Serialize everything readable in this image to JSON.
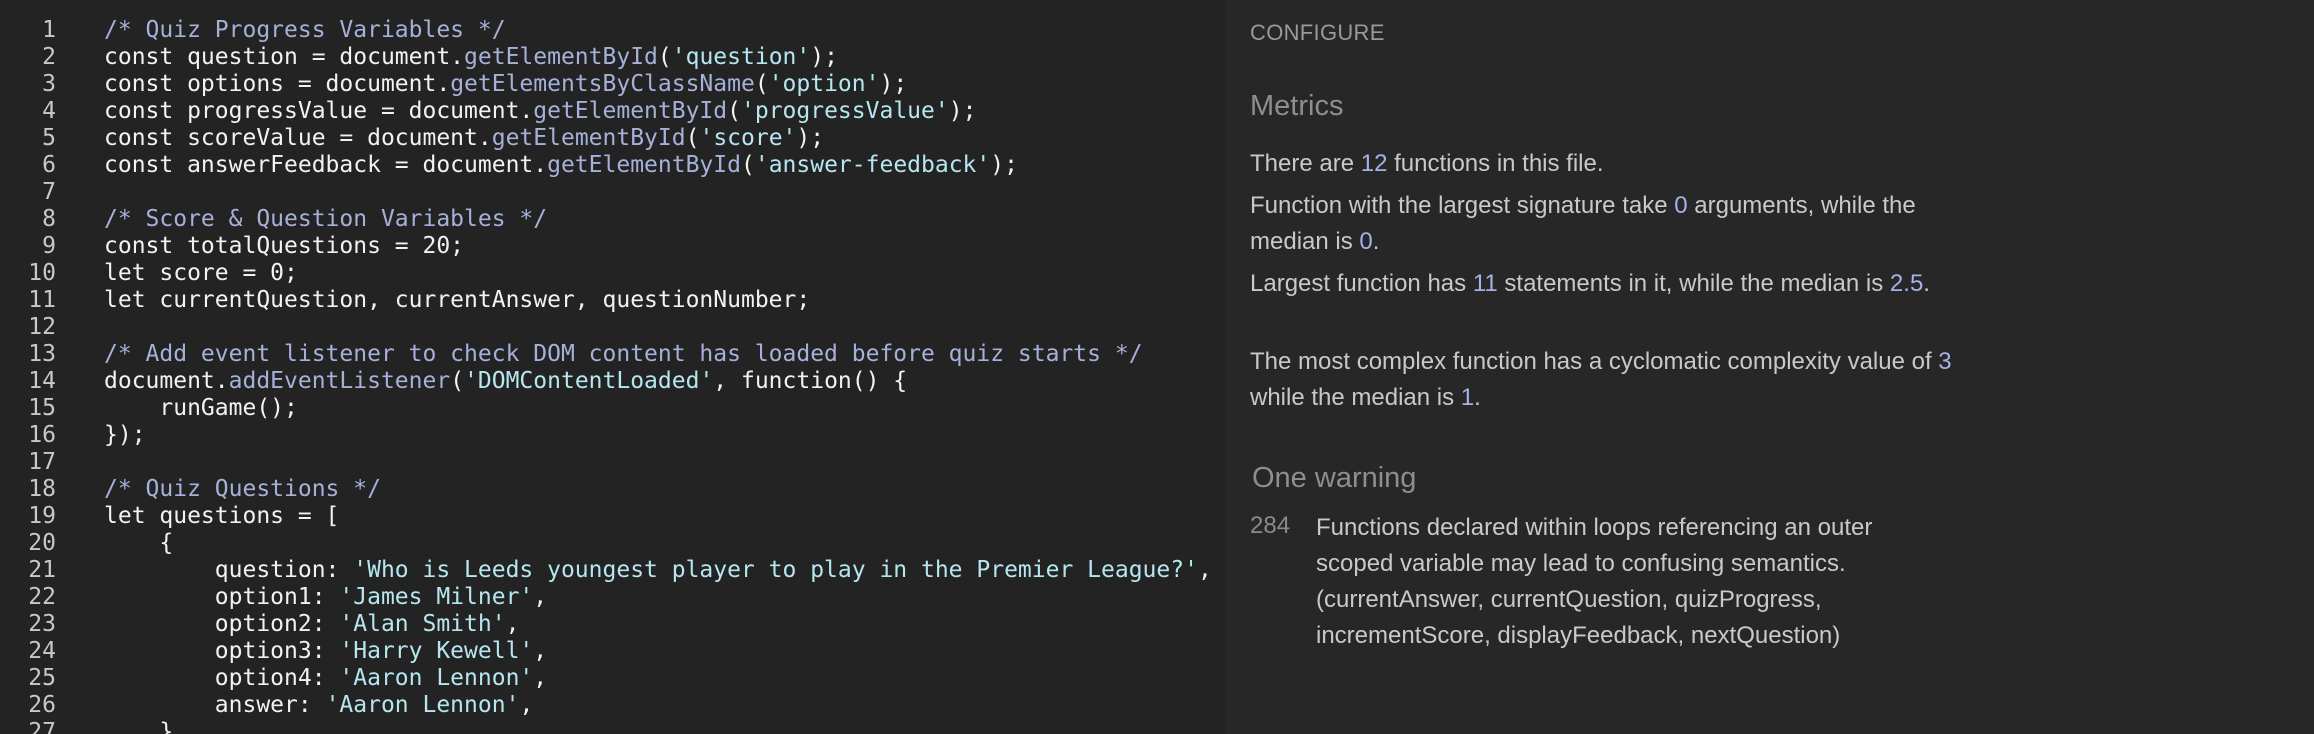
{
  "editor": {
    "lines": [
      {
        "n": "1",
        "segments": [
          {
            "t": "/* Quiz Progress Variables */",
            "c": "comment"
          }
        ]
      },
      {
        "n": "2",
        "segments": [
          {
            "t": "const question = document.",
            "c": "plain"
          },
          {
            "t": "getElementById",
            "c": "method"
          },
          {
            "t": "(",
            "c": "plain"
          },
          {
            "t": "'question'",
            "c": "string"
          },
          {
            "t": ");",
            "c": "plain"
          }
        ]
      },
      {
        "n": "3",
        "segments": [
          {
            "t": "const options = document.",
            "c": "plain"
          },
          {
            "t": "getElementsByClassName",
            "c": "method"
          },
          {
            "t": "(",
            "c": "plain"
          },
          {
            "t": "'option'",
            "c": "string"
          },
          {
            "t": ");",
            "c": "plain"
          }
        ]
      },
      {
        "n": "4",
        "segments": [
          {
            "t": "const progressValue = document.",
            "c": "plain"
          },
          {
            "t": "getElementById",
            "c": "method"
          },
          {
            "t": "(",
            "c": "plain"
          },
          {
            "t": "'progressValue'",
            "c": "string"
          },
          {
            "t": ");",
            "c": "plain"
          }
        ]
      },
      {
        "n": "5",
        "segments": [
          {
            "t": "const scoreValue = document.",
            "c": "plain"
          },
          {
            "t": "getElementById",
            "c": "method"
          },
          {
            "t": "(",
            "c": "plain"
          },
          {
            "t": "'score'",
            "c": "string"
          },
          {
            "t": ");",
            "c": "plain"
          }
        ]
      },
      {
        "n": "6",
        "segments": [
          {
            "t": "const answerFeedback = document.",
            "c": "plain"
          },
          {
            "t": "getElementById",
            "c": "method"
          },
          {
            "t": "(",
            "c": "plain"
          },
          {
            "t": "'answer-feedback'",
            "c": "string"
          },
          {
            "t": ");",
            "c": "plain"
          }
        ]
      },
      {
        "n": "7",
        "segments": []
      },
      {
        "n": "8",
        "segments": [
          {
            "t": "/* Score & Question Variables */",
            "c": "comment"
          }
        ]
      },
      {
        "n": "9",
        "segments": [
          {
            "t": "const totalQuestions = 20;",
            "c": "plain"
          }
        ]
      },
      {
        "n": "10",
        "segments": [
          {
            "t": "let score = 0;",
            "c": "plain"
          }
        ]
      },
      {
        "n": "11",
        "segments": [
          {
            "t": "let currentQuestion, currentAnswer, questionNumber;",
            "c": "plain"
          }
        ]
      },
      {
        "n": "12",
        "segments": []
      },
      {
        "n": "13",
        "segments": [
          {
            "t": "/* Add event listener to check DOM content has loaded before quiz starts */",
            "c": "comment"
          }
        ]
      },
      {
        "n": "14",
        "segments": [
          {
            "t": "document.",
            "c": "plain"
          },
          {
            "t": "addEventListener",
            "c": "method"
          },
          {
            "t": "(",
            "c": "plain"
          },
          {
            "t": "'DOMContentLoaded'",
            "c": "string"
          },
          {
            "t": ", function() {",
            "c": "plain"
          }
        ]
      },
      {
        "n": "15",
        "segments": [
          {
            "t": "    runGame();",
            "c": "plain"
          }
        ]
      },
      {
        "n": "16",
        "segments": [
          {
            "t": "});",
            "c": "plain"
          }
        ]
      },
      {
        "n": "17",
        "segments": []
      },
      {
        "n": "18",
        "segments": [
          {
            "t": "/* Quiz Questions */",
            "c": "comment"
          }
        ]
      },
      {
        "n": "19",
        "segments": [
          {
            "t": "let questions = [",
            "c": "plain"
          }
        ]
      },
      {
        "n": "20",
        "segments": [
          {
            "t": "    {",
            "c": "plain"
          }
        ]
      },
      {
        "n": "21",
        "segments": [
          {
            "t": "        question: ",
            "c": "plain"
          },
          {
            "t": "'Who is Leeds youngest player to play in the Premier League?'",
            "c": "string"
          },
          {
            "t": ",",
            "c": "plain"
          }
        ]
      },
      {
        "n": "22",
        "segments": [
          {
            "t": "        option1: ",
            "c": "plain"
          },
          {
            "t": "'James Milner'",
            "c": "string"
          },
          {
            "t": ",",
            "c": "plain"
          }
        ]
      },
      {
        "n": "23",
        "segments": [
          {
            "t": "        option2: ",
            "c": "plain"
          },
          {
            "t": "'Alan Smith'",
            "c": "string"
          },
          {
            "t": ",",
            "c": "plain"
          }
        ]
      },
      {
        "n": "24",
        "segments": [
          {
            "t": "        option3: ",
            "c": "plain"
          },
          {
            "t": "'Harry Kewell'",
            "c": "string"
          },
          {
            "t": ",",
            "c": "plain"
          }
        ]
      },
      {
        "n": "25",
        "segments": [
          {
            "t": "        option4: ",
            "c": "plain"
          },
          {
            "t": "'Aaron Lennon'",
            "c": "string"
          },
          {
            "t": ",",
            "c": "plain"
          }
        ]
      },
      {
        "n": "26",
        "segments": [
          {
            "t": "        answer: ",
            "c": "plain"
          },
          {
            "t": "'Aaron Lennon'",
            "c": "string"
          },
          {
            "t": ",",
            "c": "plain"
          }
        ]
      },
      {
        "n": "27",
        "segments": [
          {
            "t": "    },",
            "c": "plain"
          }
        ]
      }
    ]
  },
  "report": {
    "configure_label": "CONFIGURE",
    "metrics_title": "Metrics",
    "metrics": {
      "p1_a": "There are ",
      "function_count": "12",
      "p1_b": " functions in this file.",
      "p2_a": "Function with the largest signature take ",
      "max_args": "0",
      "p2_b": " arguments, while the median is ",
      "median_args": "0",
      "p2_c": ".",
      "p3_a": "Largest function has ",
      "max_statements": "11",
      "p3_b": " statements in it, while the median is ",
      "median_statements": "2.5",
      "p3_c": ".",
      "p4_a": "The most complex function has a cyclomatic complexity value of ",
      "max_complexity": "3",
      "p4_b": " while the median is ",
      "median_complexity": "1",
      "p4_c": "."
    },
    "warnings_title": "One warning",
    "warning": {
      "line": "284",
      "text": "Functions declared within loops referencing an outer scoped variable may lead to confusing semantics. (currentAnswer, currentQuestion, quizProgress, incrementScore, displayFeedback, nextQuestion)"
    }
  }
}
